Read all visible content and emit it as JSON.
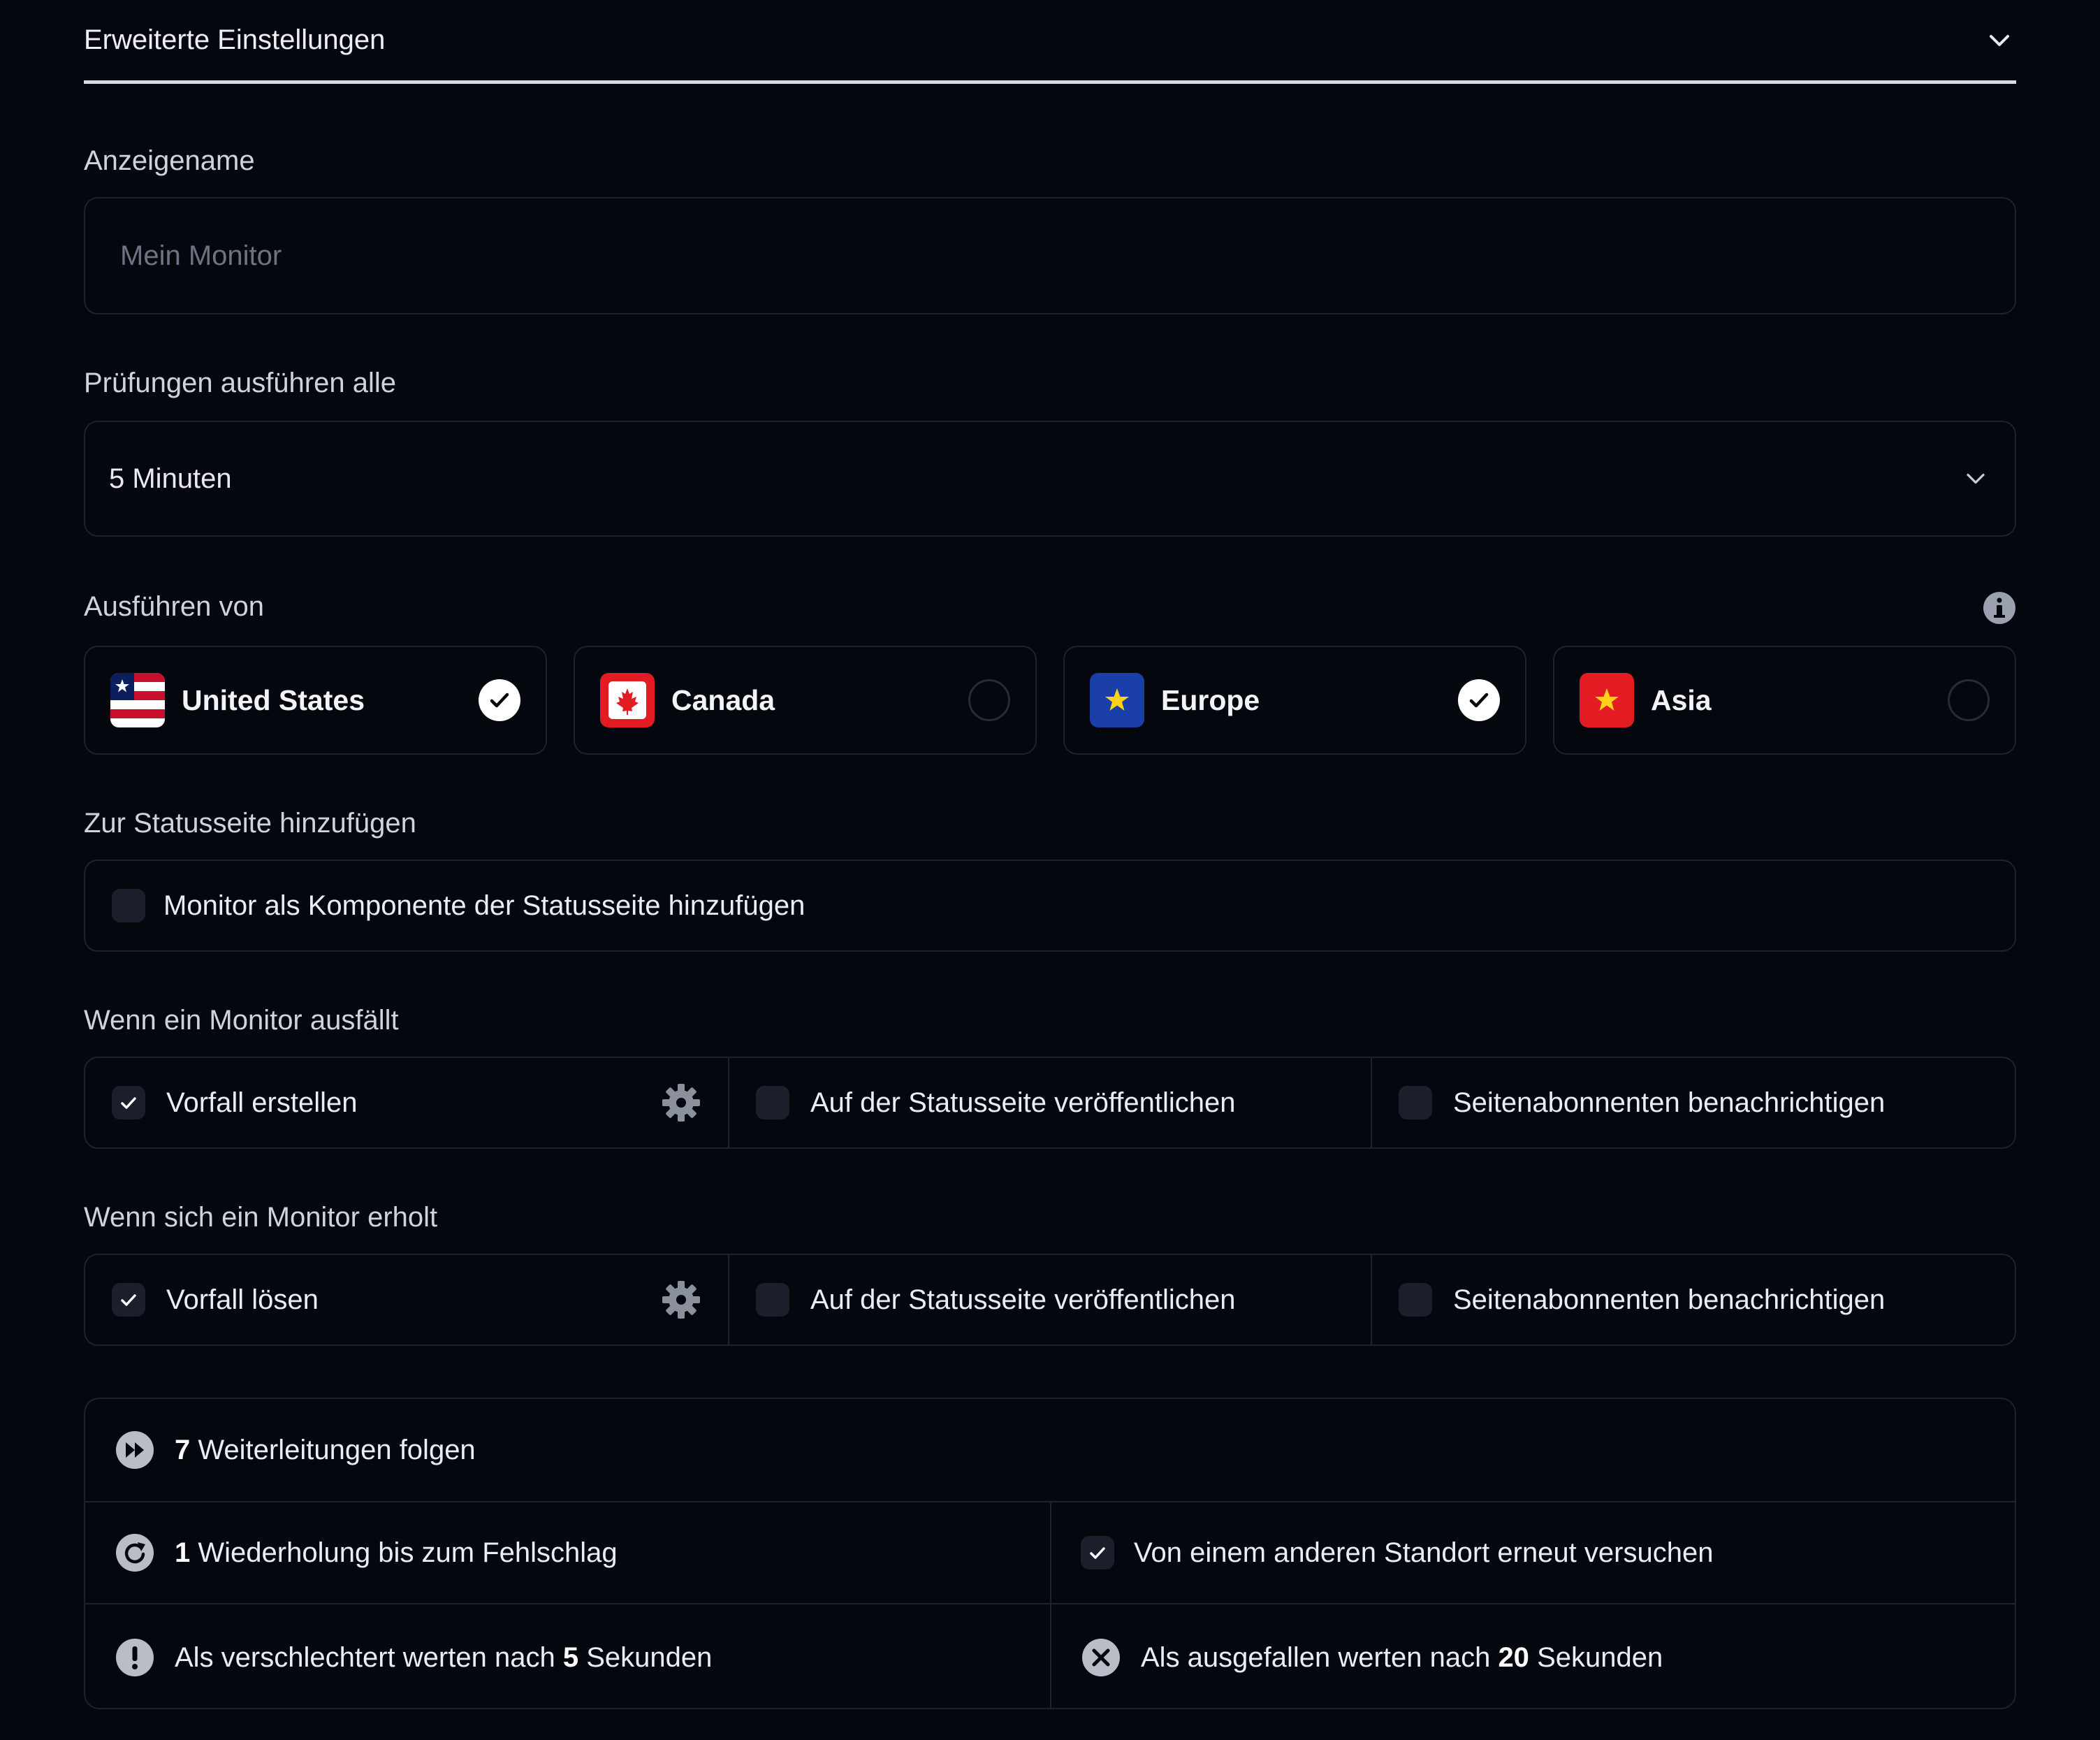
{
  "section": {
    "title": "Erweiterte Einstellungen"
  },
  "display_name": {
    "label": "Anzeigename",
    "placeholder": "Mein Monitor",
    "value": ""
  },
  "interval": {
    "label": "Prüfungen ausführen alle",
    "value": "5 Minuten"
  },
  "regions": {
    "label": "Ausführen von",
    "items": [
      {
        "name": "United States",
        "selected": true
      },
      {
        "name": "Canada",
        "selected": false
      },
      {
        "name": "Europe",
        "selected": true
      },
      {
        "name": "Asia",
        "selected": false
      }
    ]
  },
  "status_page": {
    "label": "Zur Statusseite hinzufügen",
    "option": "Monitor als Komponente der Statusseite hinzufügen",
    "checked": false
  },
  "on_down": {
    "label": "Wenn ein Monitor ausfällt",
    "create_incident": "Vorfall erstellen",
    "publish": "Auf der Statusseite veröffentlichen",
    "notify": "Seitenabonnenten benachrichtigen"
  },
  "on_recover": {
    "label": "Wenn sich ein Monitor erholt",
    "resolve_incident": "Vorfall lösen",
    "publish": "Auf der Statusseite veröffentlichen",
    "notify": "Seitenabonnenten benachrichtigen"
  },
  "advanced": {
    "redirects_count": "7",
    "redirects_text": "Weiterleitungen folgen",
    "retries_count": "1",
    "retries_text": "Wiederholung bis zum Fehlschlag",
    "retry_other_location": "Von einem anderen Standort erneut versuchen",
    "degraded_prefix": "Als verschlechtert werten nach",
    "degraded_value": "5",
    "degraded_suffix": "Sekunden",
    "down_prefix": "Als ausgefallen werten nach",
    "down_value": "20",
    "down_suffix": "Sekunden"
  },
  "colors": {
    "background": "#05070f",
    "border": "#1d2230",
    "canada_red": "#e31b23",
    "europe_blue": "#1a3fa8",
    "asia_red": "#e31b23",
    "star_yellow": "#ffd21a"
  }
}
